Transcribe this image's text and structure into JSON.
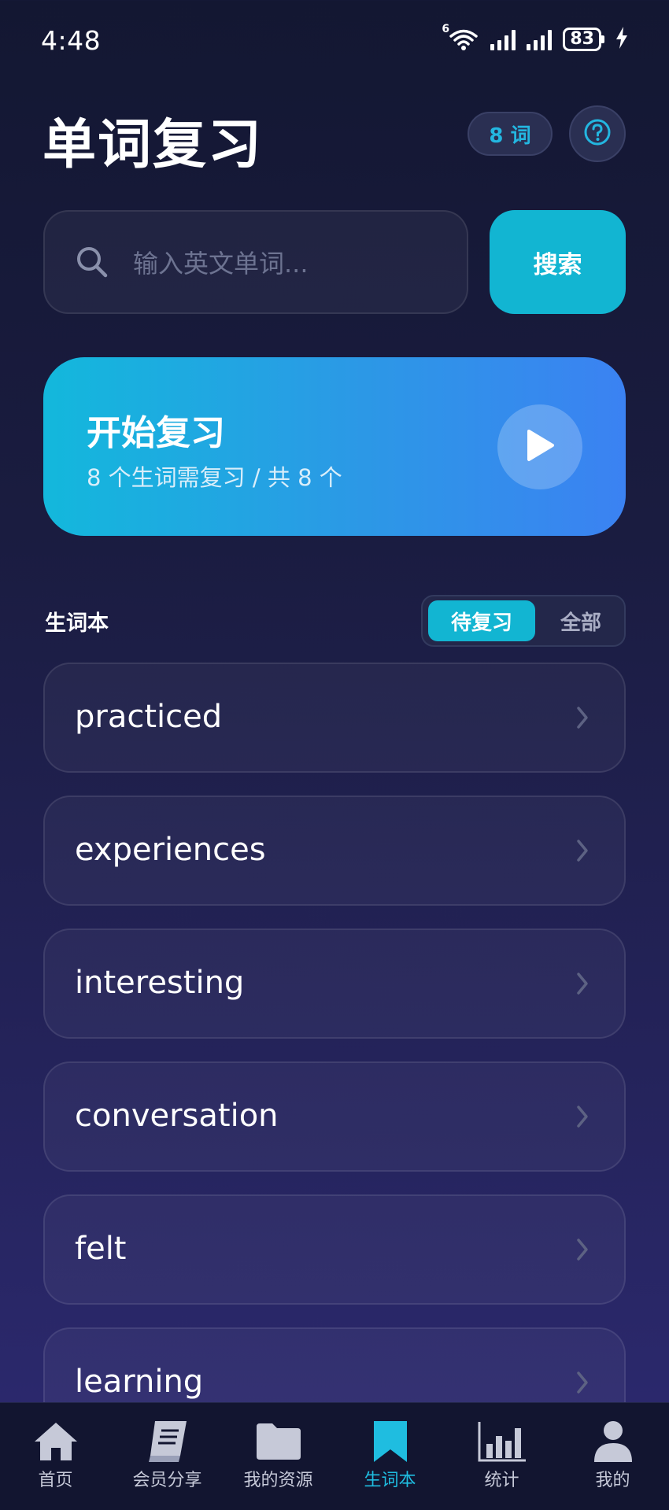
{
  "status_bar": {
    "time": "4:48",
    "battery": "83",
    "network_badge": "6"
  },
  "header": {
    "title": "单词复习",
    "word_count": "8 词"
  },
  "search": {
    "placeholder": "输入英文单词...",
    "button_label": "搜索"
  },
  "review_card": {
    "title": "开始复习",
    "subtitle": "8 个生词需复习 / 共 8 个"
  },
  "section": {
    "label": "生词本",
    "filter_options": [
      "待复习",
      "全部"
    ],
    "active_filter": "待复习"
  },
  "words": [
    "practiced",
    "experiences",
    "interesting",
    "conversation",
    "felt",
    "learning"
  ],
  "tabs": [
    {
      "label": "首页",
      "icon": "home-icon"
    },
    {
      "label": "会员分享",
      "icon": "book-icon"
    },
    {
      "label": "我的资源",
      "icon": "folder-icon"
    },
    {
      "label": "生词本",
      "icon": "bookmark-icon",
      "active": true
    },
    {
      "label": "统计",
      "icon": "bar-chart-icon"
    },
    {
      "label": "我的",
      "icon": "user-icon"
    }
  ],
  "colors": {
    "accent": "#12b5d2",
    "card_start": "#13b8dc",
    "card_end": "#3b82f2",
    "background": "#1a1c40"
  }
}
